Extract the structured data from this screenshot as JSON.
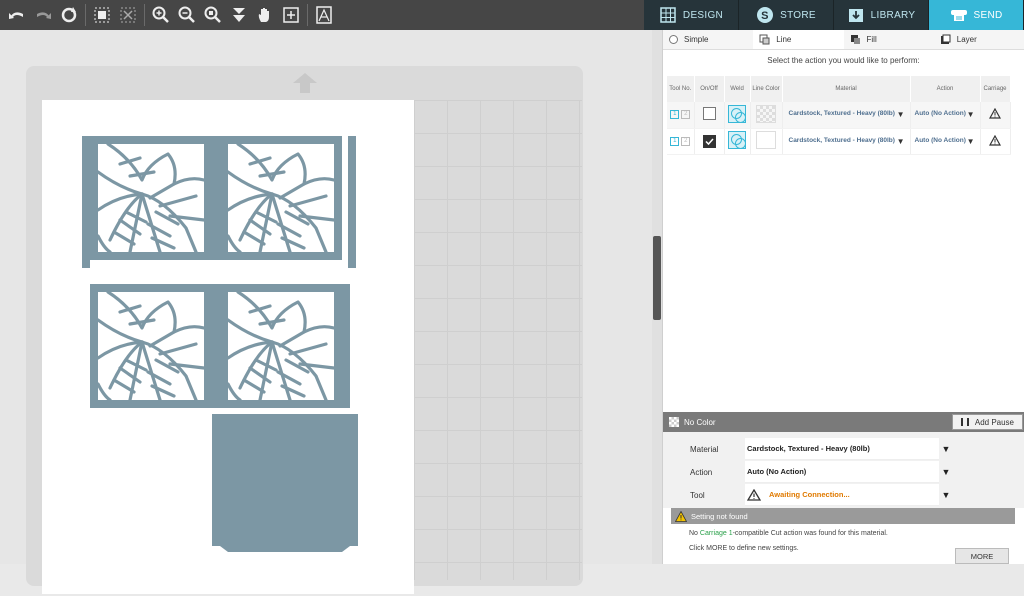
{
  "nav": {
    "tabs": [
      {
        "label": "DESIGN"
      },
      {
        "label": "STORE"
      },
      {
        "label": "LIBRARY"
      },
      {
        "label": "SEND"
      }
    ]
  },
  "mode_tabs": [
    {
      "label": "Simple"
    },
    {
      "label": "Line"
    },
    {
      "label": "Fill"
    },
    {
      "label": "Layer"
    }
  ],
  "instruction": "Select the action you would like to perform:",
  "table": {
    "headers": [
      "Tool No.",
      "On/Off",
      "Weld",
      "Line Color",
      "Material",
      "Action",
      "Carriage"
    ],
    "rows": [
      {
        "tool1": "1",
        "tool2": "2",
        "on": false,
        "material": "Cardstock, Textured - Heavy (80lb)",
        "action": "Auto (No Action)"
      },
      {
        "tool1": "1",
        "tool2": "2",
        "on": true,
        "material": "Cardstock, Textured - Heavy (80lb)",
        "action": "Auto (No Action)"
      }
    ]
  },
  "settings": {
    "color_label": "No Color",
    "add_pause": "Add Pause",
    "material_label": "Material",
    "material_value": "Cardstock, Textured - Heavy (80lb)",
    "action_label": "Action",
    "action_value": "Auto (No Action)",
    "tool_label": "Tool",
    "tool_value": "Awaiting Connection...",
    "tool_value_color": "#e07a00"
  },
  "notice": {
    "title": "Setting not found",
    "line1_pre": "No ",
    "line1_link": "Carriage 1",
    "line1_post": "-compatible Cut action was found for this material.",
    "line2": "Click MORE to define new settings.",
    "more": "MORE"
  },
  "colors": {
    "accent": "#36b7d7",
    "shape": "#7c97a4",
    "link": "#2aa04a"
  }
}
